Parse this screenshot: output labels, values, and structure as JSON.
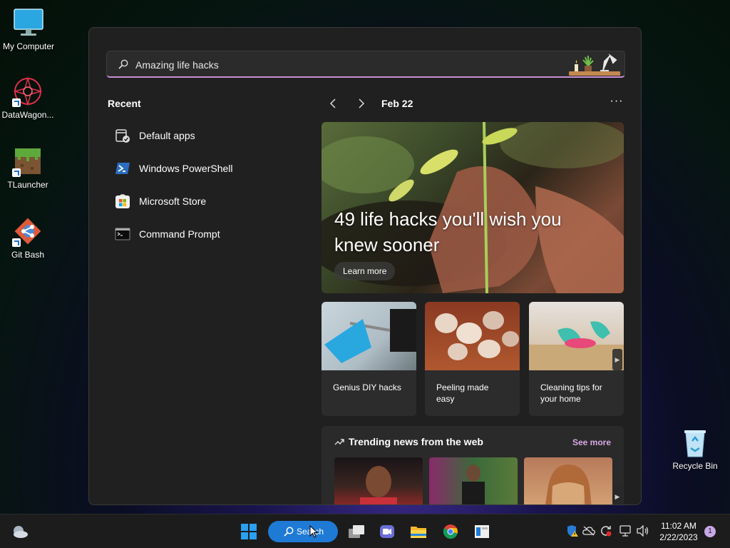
{
  "desktop": {
    "icons": [
      {
        "label": "My Computer",
        "icon": "monitor-icon"
      },
      {
        "label": "DataWagon...",
        "icon": "datawagon-icon"
      },
      {
        "label": "TLauncher",
        "icon": "grass-block-icon"
      },
      {
        "label": "Git Bash",
        "icon": "git-icon"
      },
      {
        "label": "Recycle Bin",
        "icon": "recycle-bin-icon"
      }
    ]
  },
  "search": {
    "value": "Amazing life hacks",
    "placeholder": ""
  },
  "recent": {
    "title": "Recent",
    "items": [
      {
        "label": "Default apps",
        "icon": "default-apps-icon"
      },
      {
        "label": "Windows PowerShell",
        "icon": "powershell-icon"
      },
      {
        "label": "Microsoft Store",
        "icon": "store-icon"
      },
      {
        "label": "Command Prompt",
        "icon": "cmd-icon"
      }
    ]
  },
  "nav": {
    "date": "Feb 22",
    "more": "···"
  },
  "hero": {
    "title": "49 life hacks you'll wish you knew sooner",
    "button": "Learn more"
  },
  "cards": [
    {
      "label": "Genius DIY hacks"
    },
    {
      "label": "Peeling made easy"
    },
    {
      "label": "Cleaning tips for your home"
    }
  ],
  "trending": {
    "title": "Trending news from the web",
    "more": "See more"
  },
  "taskbar": {
    "search_label": "Search",
    "clock_time": "11:02 AM",
    "clock_date": "2/22/2023",
    "notifications": "1"
  },
  "colors": {
    "accent": "#1f7ad6",
    "search_underline": "#c88fd6",
    "see_more": "#d7a8e6"
  }
}
